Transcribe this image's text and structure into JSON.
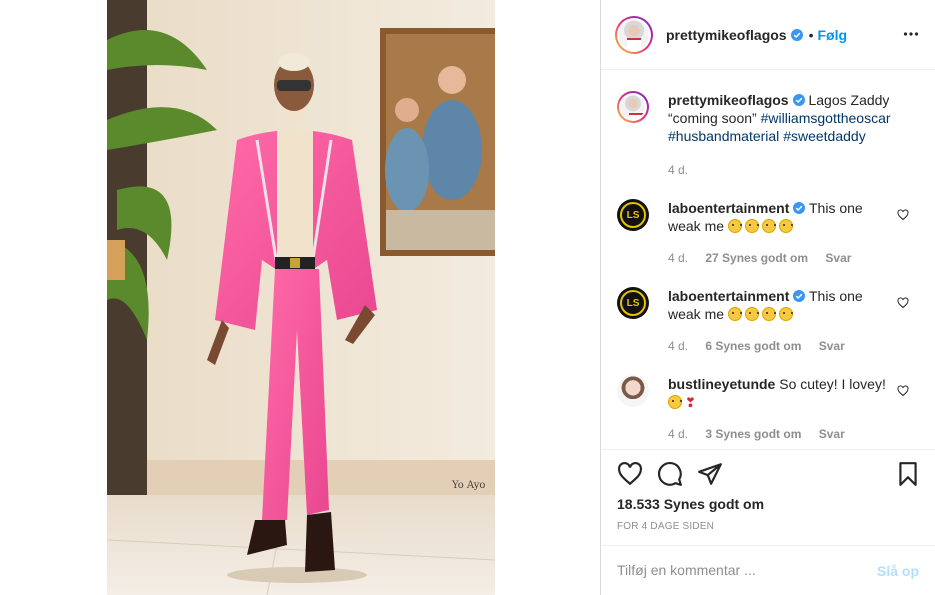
{
  "post": {
    "username": "prettymikeoflagos",
    "follow_label": "Følg",
    "separator": "•",
    "more_icon": "more-options-icon"
  },
  "caption": {
    "username": "prettymikeoflagos",
    "text": "Lagos Zaddy “coming soon”",
    "hashtags": [
      "#williamsgottheoscar",
      "#husbandmaterial",
      "#sweetdaddy"
    ],
    "age": "4 d."
  },
  "comments": [
    {
      "username": "laboentertainment",
      "text": "This one weak me",
      "emoji_count": 4,
      "age": "4 d.",
      "likes": "27 Synes godt om",
      "reply": "Svar"
    },
    {
      "username": "laboentertainment",
      "text": "This one weak me",
      "emoji_count": 4,
      "age": "4 d.",
      "likes": "6 Synes godt om",
      "reply": "Svar"
    },
    {
      "username": "bustlineyetunde",
      "text": "So cutey! I lovey!",
      "age": "4 d.",
      "likes": "3 Synes godt om",
      "reply": "Svar"
    }
  ],
  "avatar_badge": "LS",
  "actions": {
    "like_icon": "heart-icon",
    "comment_icon": "comment-icon",
    "share_icon": "paper-plane-icon",
    "save_icon": "bookmark-icon"
  },
  "likes_label": "18.533 Synes godt om",
  "date_label": "FOR 4 DAGE SIDEN",
  "comment_box": {
    "placeholder": "Tilføj en kommentar ...",
    "post_label": "Slå op"
  },
  "photo_watermark": "Yo Ayo",
  "colors": {
    "link": "#0095f6",
    "hashtag": "#00376b",
    "suit_pink": "#f0579a",
    "muted": "#8e8e8e"
  }
}
